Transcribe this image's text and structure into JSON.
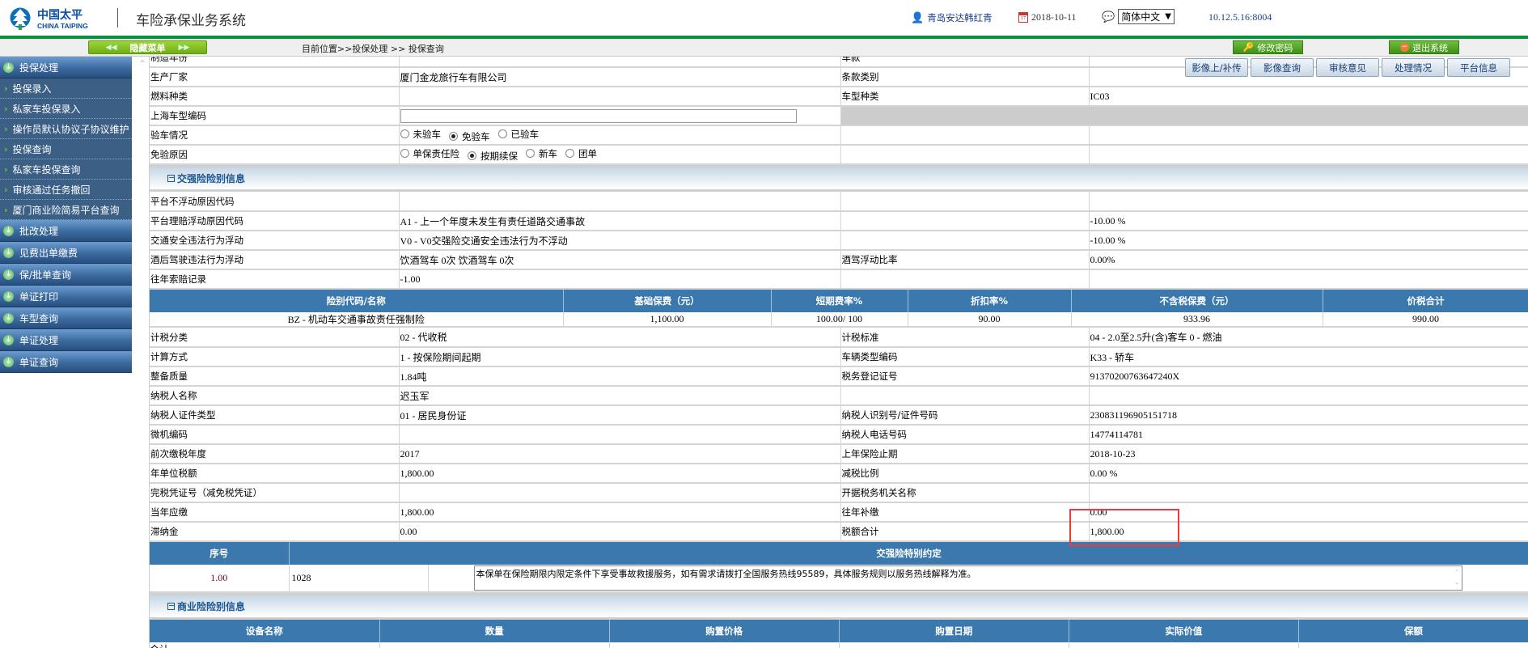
{
  "header": {
    "logo_cn": "中国太平",
    "logo_en": "CHINA TAIPING",
    "app_title": "车险承保业务系统",
    "user": "青岛安达韩红青",
    "date": "2018-10-11",
    "language": "简体中文",
    "server": "10.12.5.16:8004"
  },
  "toolbar": {
    "hide_menu": "隐藏菜单",
    "breadcrumb": "目前位置>>投保处理 >> 投保查询",
    "change_password": "修改密码",
    "logout": "退出系统"
  },
  "actions": [
    "影像上/补传",
    "影像查询",
    "审核意见",
    "处理情况",
    "平台信息"
  ],
  "sidebar": {
    "sections": [
      {
        "label": "投保处理",
        "items": [
          "投保录入",
          "私家车投保录入",
          "操作员默认协议子协议维护",
          "投保查询",
          "私家车投保查询",
          "审核通过任务撤回",
          "厦门商业险简易平台查询"
        ]
      },
      {
        "label": "批改处理",
        "items": []
      },
      {
        "label": "见费出单缴费",
        "items": []
      },
      {
        "label": "保/批单查询",
        "items": []
      },
      {
        "label": "单证打印",
        "items": []
      },
      {
        "label": "车型查询",
        "items": []
      },
      {
        "label": "单证处理",
        "items": []
      },
      {
        "label": "单证查询",
        "items": []
      }
    ]
  },
  "vehicle_rows": [
    [
      "制造年份",
      "",
      "车款",
      ""
    ],
    [
      "生产厂家",
      "厦门金龙旅行车有限公司",
      "条款类别",
      ""
    ],
    [
      "燃料种类",
      "",
      "车型种类",
      "IC03"
    ]
  ],
  "shanghai_code": {
    "label": "上海车型编码",
    "value": ""
  },
  "inspection": {
    "label": "验车情况",
    "options": [
      "未验车",
      "免验车",
      "已验车"
    ],
    "selected": 1
  },
  "exemption": {
    "label": "免验原因",
    "options": [
      "单保责任险",
      "按期续保",
      "新车",
      "团单"
    ],
    "selected": 1
  },
  "ctp_section": "交强险险别信息",
  "ctp_rows": [
    [
      "平台不浮动原因代码",
      "",
      "",
      ""
    ],
    [
      "平台理赔浮动原因代码",
      "A1 - 上一个年度未发生有责任道路交通事故",
      "",
      "-10.00 %"
    ],
    [
      "交通安全违法行为浮动",
      "V0 - V0交强险交通安全违法行为不浮动",
      "",
      "-10.00 %"
    ],
    [
      "酒后驾驶违法行为浮动",
      "饮酒驾车  0次  饮酒驾车  0次",
      "酒驾浮动比率",
      "0.00%"
    ],
    [
      "往年索赔记录",
      "-1.00",
      "",
      ""
    ]
  ],
  "premium_table": {
    "headers": [
      "险别代码/名称",
      "基础保费（元）",
      "短期费率%",
      "折扣率%",
      "不含税保费（元）",
      "价税合计"
    ],
    "rows": [
      [
        "BZ - 机动车交通事故责任强制险",
        "1,100.00",
        "100.00/ 100",
        "90.00",
        "933.96",
        "990.00"
      ]
    ]
  },
  "tax_rows": [
    [
      "计税分类",
      "02 - 代收税",
      "计税标准",
      "04 - 2.0至2.5升(含)客车  0 - 燃油"
    ],
    [
      "计算方式",
      "1 - 按保险期间起期",
      "车辆类型编码",
      "K33 - 轿车"
    ],
    [
      "整备质量",
      "1.84吨",
      "税务登记证号",
      "91370200763647240X"
    ],
    [
      "纳税人名称",
      "迟玉军",
      "",
      ""
    ],
    [
      "纳税人证件类型",
      "01 - 居民身份证",
      "纳税人识别号/证件号码",
      "230831196905151718"
    ],
    [
      "微机编码",
      "",
      "纳税人电话号码",
      "14774114781"
    ],
    [
      "前次缴税年度",
      "2017",
      "上年保险止期",
      "2018-10-23"
    ],
    [
      "年单位税额",
      "1,800.00",
      "减税比例",
      "0.00 %"
    ],
    [
      "完税凭证号（减免税凭证）",
      "",
      "开据税务机关名称",
      ""
    ],
    [
      "当年应缴",
      "1,800.00",
      "往年补缴",
      "0.00"
    ],
    [
      "滞纳金",
      "0.00",
      "税额合计",
      "1,800.00"
    ]
  ],
  "special_terms": {
    "headers": [
      "序号",
      "交强险特别约定"
    ],
    "rows": [
      {
        "seq": "1.00",
        "code": "1028",
        "text": "本保单在保险期限内限定条件下享受事故救援服务，如有需求请拨打全国服务热线95589，具体服务规则以服务热线解释为准。"
      }
    ]
  },
  "commercial_section": "商业险险别信息",
  "equipment_table": {
    "headers": [
      "设备名称",
      "数量",
      "购置价格",
      "购置日期",
      "实际价值",
      "保额"
    ],
    "total_label": "合计"
  }
}
